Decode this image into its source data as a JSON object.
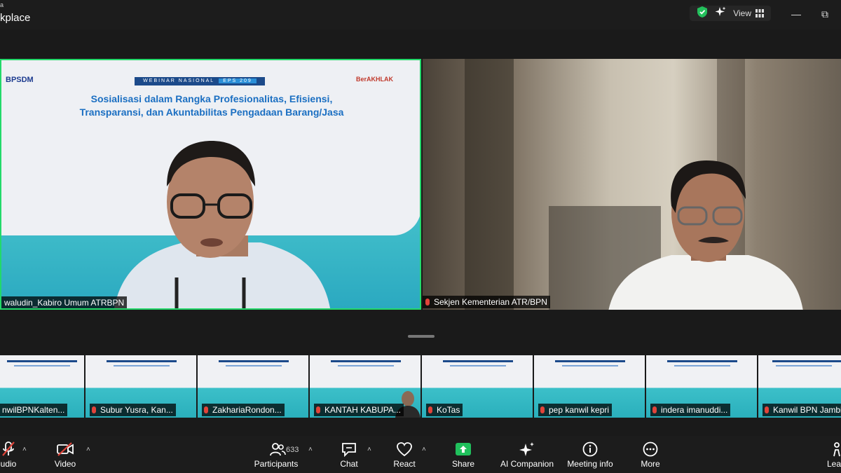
{
  "titlebar": {
    "app_name_top": "a",
    "app_name": "kplace",
    "view_label": "View",
    "minimize": "—",
    "restore": "⧉"
  },
  "main": {
    "left_tile": {
      "logo_left": "BPSDM",
      "webinar_label": "WEBINAR NASIONAL",
      "eps_label": "EPS 209",
      "logo_right": "BerAKHLAK",
      "slide_title_line1": "Sosialisasi dalam Rangka Profesionalitas, Efisiensi,",
      "slide_title_line2": "Transparansi, dan Akuntabilitas Pengadaan Barang/Jasa",
      "name": "waludin_Kabiro Umum ATRBPN"
    },
    "right_tile": {
      "name": "Sekjen Kementerian ATR/BPN"
    }
  },
  "thumbnails": [
    {
      "name": "nwilBPNKalten..."
    },
    {
      "name": "Subur Yusra, Kan..."
    },
    {
      "name": "ZakhariaRondon..."
    },
    {
      "name": "KANTAH KABUPA..."
    },
    {
      "name": "KoTas"
    },
    {
      "name": "pep kanwil kepri"
    },
    {
      "name": "indera imanuddi..."
    },
    {
      "name": "Kanwil BPN Jambi"
    }
  ],
  "toolbar": {
    "audio": "udio",
    "video": "Video",
    "participants": "Participants",
    "participants_count": "633",
    "chat": "Chat",
    "react": "React",
    "share": "Share",
    "ai_companion": "AI Companion",
    "meeting_info": "Meeting info",
    "more": "More",
    "leave": "Lea"
  },
  "colors": {
    "active_speaker_border": "#23d96a",
    "share_green": "#20c05c",
    "mute_red": "#e0443a",
    "shield_green": "#23c05c"
  }
}
